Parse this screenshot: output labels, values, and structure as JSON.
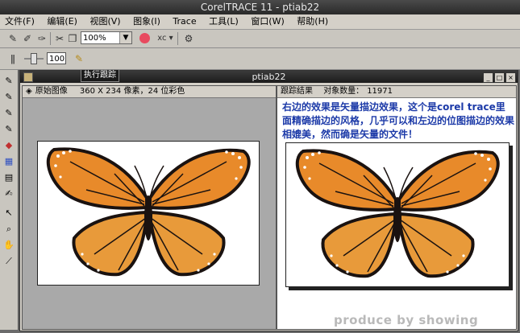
{
  "app": {
    "title": "CorelTRACE 11 - ptiab22"
  },
  "menu": [
    "文件(F)",
    "编辑(E)",
    "视图(V)",
    "图象(I)",
    "Trace",
    "工具(L)",
    "窗口(W)",
    "帮助(H)"
  ],
  "toolbar": {
    "zoom_value": "100%",
    "dropdown_label": "xc ▾",
    "number_value": "100"
  },
  "tooltip": "执行跟踪",
  "document": {
    "title": "ptiab22"
  },
  "left_pane": {
    "header_label": "原始图像",
    "header_info": "360 X 234 像素，24 位彩色"
  },
  "right_pane": {
    "header_label": "跟踪结果",
    "object_count_label": "对象数量：",
    "object_count": "11971",
    "caption": "右边的效果是矢量描边效果，这个是corel trace里面精确描边的风格，几乎可以和左边的位图描边的效果相媲美，然而确是矢量的文件！",
    "watermark": "produce by showing"
  },
  "colors": {
    "orange": "#e88a2a",
    "dark": "#1a1210",
    "caption_blue": "#1c3aa8",
    "accent_red": "#e84a5f"
  },
  "icons": [
    "paint-bucket-icon",
    "magic-wand-icon",
    "gear-icon",
    "pointer-icon",
    "zoom-icon",
    "hand-icon",
    "ruler-icon"
  ]
}
